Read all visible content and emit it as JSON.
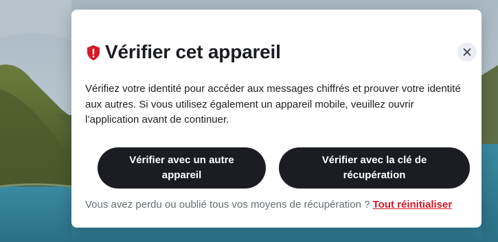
{
  "dialog": {
    "title": "Vérifier cet appareil",
    "description": "Vérifiez votre identité pour accéder aux messages chiffrés et prouver votre identité aux autres. Si vous utilisez également un appareil mobile, veuillez ouvrir l’application avant de continuer.",
    "buttons": {
      "verify_other_device": "Vérifier avec un autre appareil",
      "verify_recovery_key": "Vérifier avec la clé de récupération"
    },
    "footer": {
      "text": "Vous avez perdu ou oublié tous vos moyens de récupération ?",
      "reset_link": "Tout réinitialiser"
    }
  },
  "colors": {
    "accent_critical": "#d51928",
    "button_bg": "#1b1d22",
    "text_primary": "#1b1d22",
    "text_secondary": "#656d77"
  },
  "icons": {
    "title_icon": "shield-error-icon",
    "close_icon": "close-icon"
  }
}
